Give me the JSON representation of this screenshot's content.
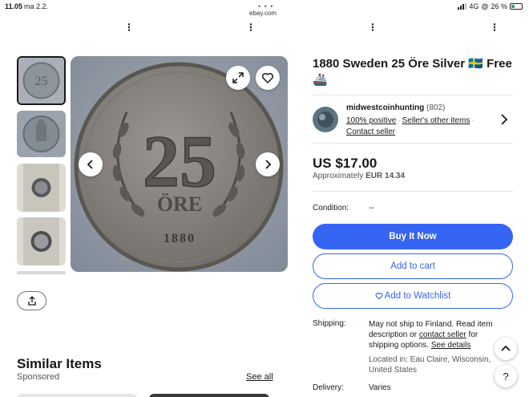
{
  "status_bar": {
    "time": "11.05",
    "date": "ma 2.2.",
    "url": "ebay.com",
    "network": "4G",
    "battery": "26 %"
  },
  "listing": {
    "title": "1880 Sweden 25 Öre Silver 🇸🇪 Free 🚢",
    "price": "US $17.00",
    "approx_prefix": "Approximately",
    "approx_value": "EUR 14.34",
    "condition_label": "Condition:",
    "condition_value": "--"
  },
  "seller": {
    "name": "midwestcoinhunting",
    "feedback_count": "(802)",
    "positive": "100% positive",
    "other_items": "Seller's other items",
    "contact": "Contact seller"
  },
  "buttons": {
    "buy_now": "Buy It Now",
    "add_to_cart": "Add to cart",
    "watchlist": "Add to Watchlist"
  },
  "shipping": {
    "label": "Shipping:",
    "text_1": "May not ship to Finland. Read item description or ",
    "contact_link": "contact seller",
    "text_2": " for shipping options. ",
    "details_link": "See details",
    "location": "Located in: Eau Claire, Wisconsin, United States"
  },
  "delivery": {
    "label": "Delivery:",
    "value": "Varies"
  },
  "similar": {
    "title": "Similar Items",
    "sponsored": "Sponsored",
    "see_all": "See all"
  },
  "coin": {
    "numeral": "25",
    "denomination": "ÖRE",
    "year": "1880"
  },
  "help": "?",
  "colors": {
    "accent": "#3665f3",
    "text": "#191919"
  },
  "icons": [
    "expand-icon",
    "heart-icon",
    "chevron-left-icon",
    "chevron-right-icon",
    "share-icon",
    "chevron-up-icon",
    "help-icon"
  ]
}
